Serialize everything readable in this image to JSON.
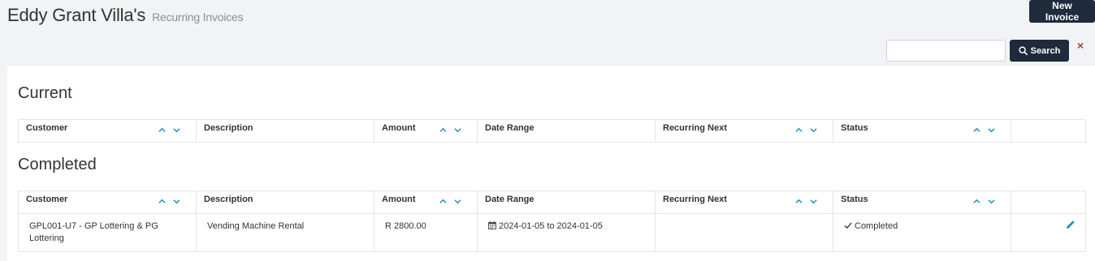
{
  "header": {
    "title": "Eddy Grant Villa's",
    "subtitle": "Recurring Invoices",
    "new_invoice_label": "New Invoice"
  },
  "search": {
    "value": "",
    "placeholder": "",
    "button_label": "Search",
    "clear_label": "×"
  },
  "columns": [
    "Customer",
    "Description",
    "Amount",
    "Date Range",
    "Recurring Next",
    "Status",
    ""
  ],
  "sortable_columns": [
    "Customer",
    "Amount",
    "Recurring Next",
    "Status"
  ],
  "sections": {
    "current": {
      "title": "Current",
      "rows": []
    },
    "completed": {
      "title": "Completed",
      "rows": [
        {
          "customer": "GPL001-U7 - GP Lottering & PG Lottering",
          "description": "Vending Machine Rental",
          "amount": "R 2800.00",
          "date_range": "2024-01-05 to 2024-01-05",
          "recurring_next": "",
          "status": "Completed"
        }
      ]
    }
  },
  "icons": {
    "search": "search-icon",
    "sort_up": "chevron-up-icon",
    "sort_down": "chevron-down-icon",
    "calendar": "calendar-icon",
    "check": "check-icon",
    "edit": "pencil-icon"
  },
  "colors": {
    "primary_button": "#1f2a3d",
    "sort_arrow": "#2a8fb8",
    "clear_x": "#b23b3b",
    "edit_icon": "#2a8fb8"
  }
}
